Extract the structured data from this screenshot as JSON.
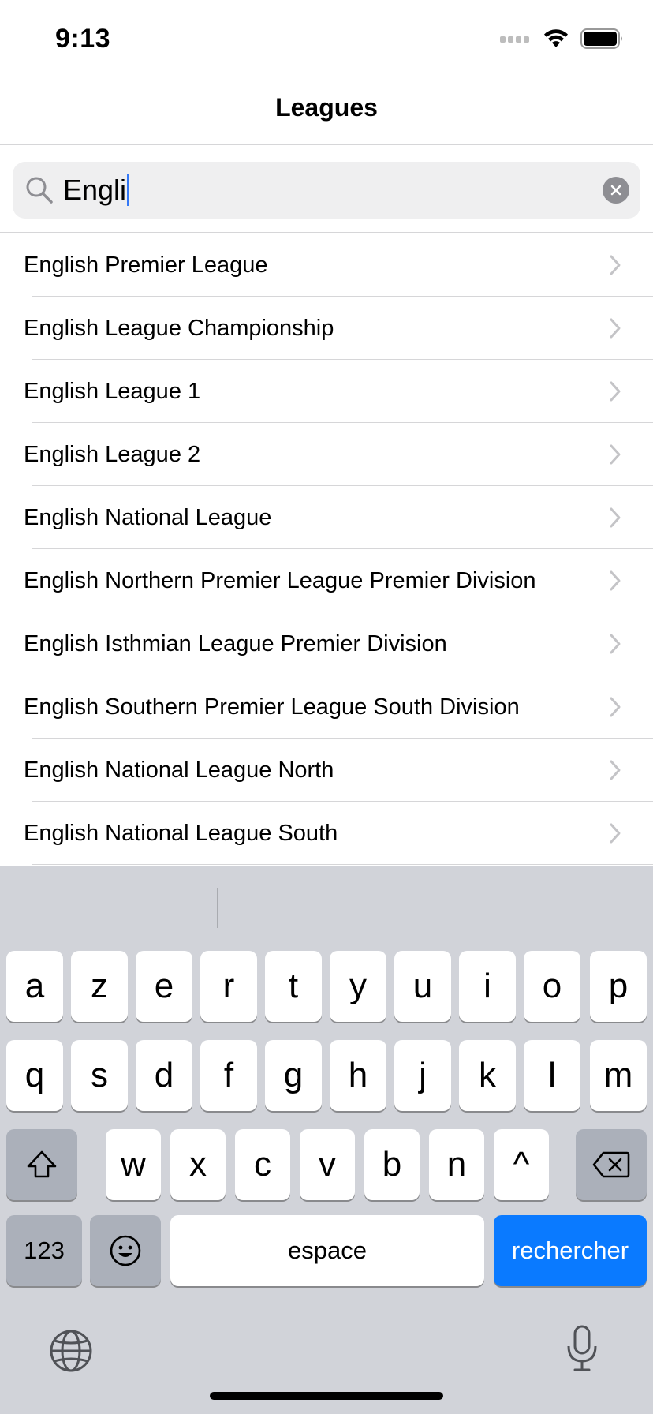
{
  "status": {
    "time": "9:13"
  },
  "nav": {
    "title": "Leagues"
  },
  "search": {
    "value": "Engli",
    "icon": "magnifier-icon",
    "clear_icon": "clear-icon"
  },
  "leagues": [
    {
      "label": "English Premier League"
    },
    {
      "label": "English League Championship"
    },
    {
      "label": "English League 1"
    },
    {
      "label": "English League 2"
    },
    {
      "label": "English National League"
    },
    {
      "label": "English Northern Premier League Premier Division"
    },
    {
      "label": "English Isthmian League Premier Division"
    },
    {
      "label": "English Southern Premier League South Division"
    },
    {
      "label": "English National League North"
    },
    {
      "label": "English National League South"
    }
  ],
  "keyboard": {
    "row1": [
      "a",
      "z",
      "e",
      "r",
      "t",
      "y",
      "u",
      "i",
      "o",
      "p"
    ],
    "row2": [
      "q",
      "s",
      "d",
      "f",
      "g",
      "h",
      "j",
      "k",
      "l",
      "m"
    ],
    "row3": [
      "w",
      "x",
      "c",
      "v",
      "b",
      "n",
      "^"
    ],
    "numbers_label": "123",
    "space_label": "espace",
    "action_label": "rechercher",
    "accent_color": "#0a7aff"
  }
}
